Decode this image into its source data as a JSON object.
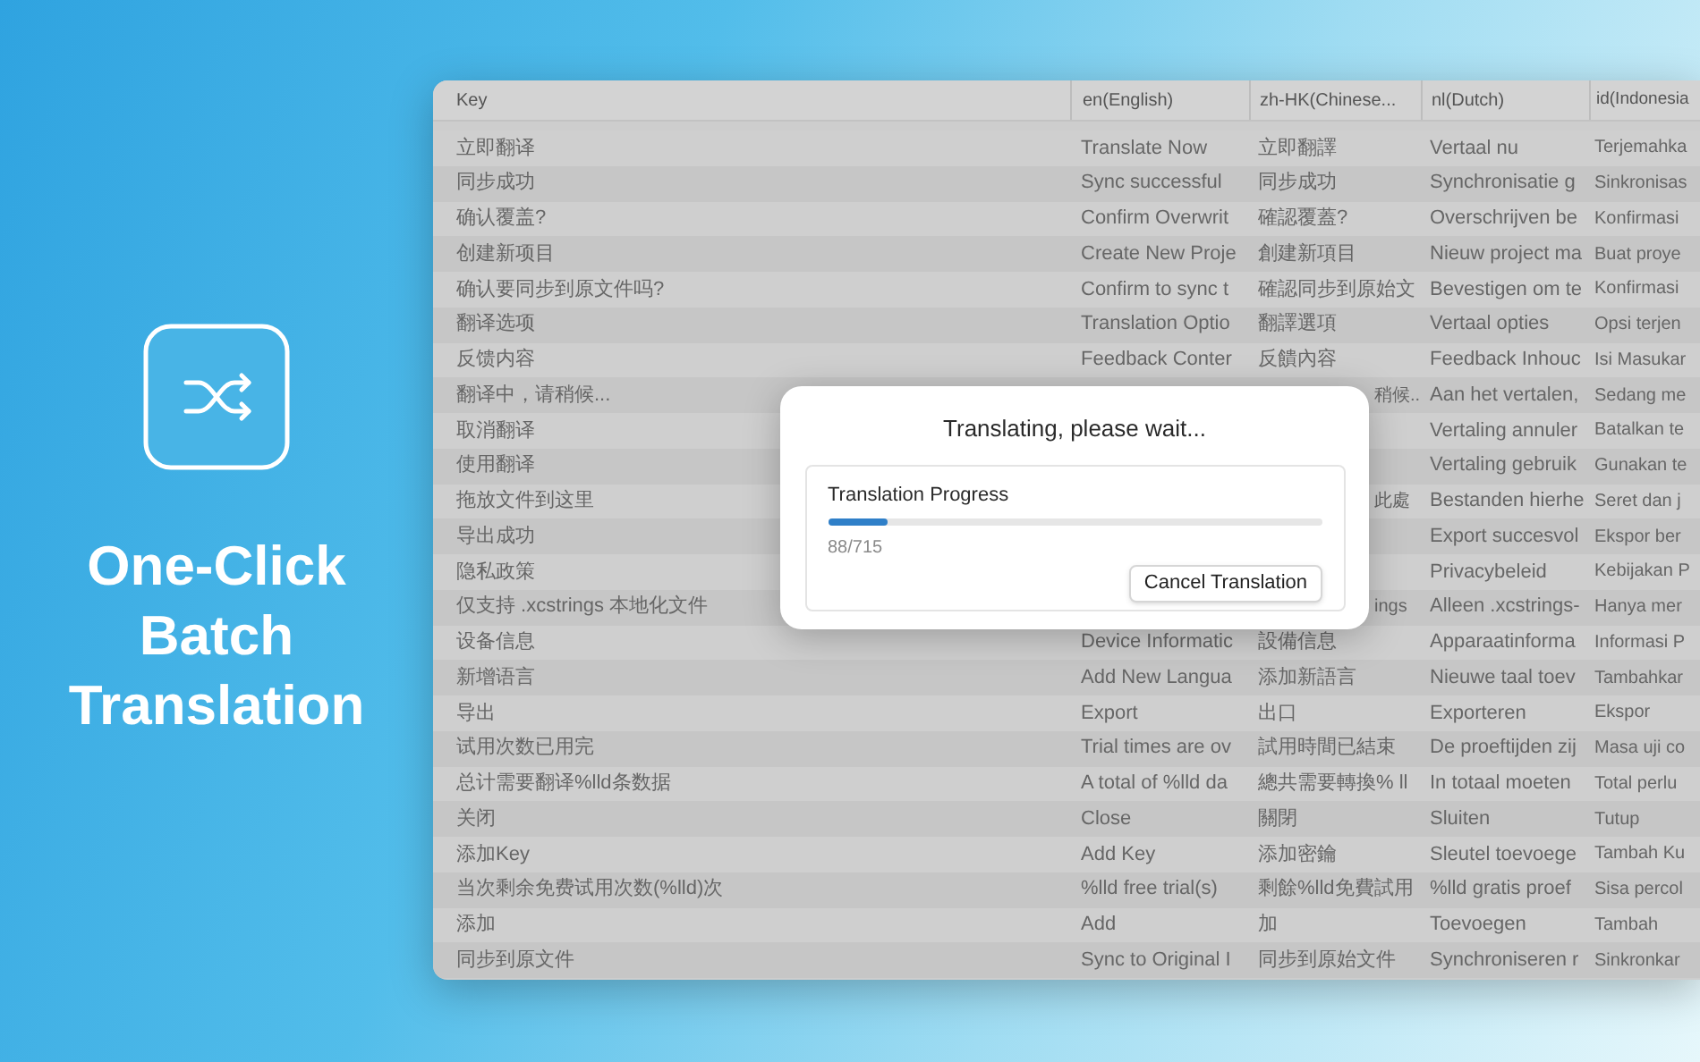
{
  "promo": {
    "headline": [
      "One-Click",
      "Batch",
      "Translation"
    ]
  },
  "table": {
    "columns": [
      "Key",
      "en(English)",
      "zh-HK(Chinese...",
      "nl(Dutch)",
      "id(Indonesia"
    ],
    "rows": [
      {
        "key": "立即翻译",
        "en": "Translate Now",
        "zh_hk": "立即翻譯",
        "nl": "Vertaal nu",
        "id": "Terjemahka"
      },
      {
        "key": "同步成功",
        "en": "Sync successful",
        "zh_hk": "同步成功",
        "nl": "Synchronisatie g",
        "id": "Sinkronisas"
      },
      {
        "key": "确认覆盖?",
        "en": "Confirm Overwrit",
        "zh_hk": "確認覆蓋?",
        "nl": "Overschrijven be",
        "id": "Konfirmasi"
      },
      {
        "key": "创建新项目",
        "en": "Create New Proje",
        "zh_hk": "創建新項目",
        "nl": "Nieuw project ma",
        "id": "Buat proye"
      },
      {
        "key": "确认要同步到原文件吗?",
        "en": "Confirm to sync t",
        "zh_hk": "確認同步到原始文",
        "nl": "Bevestigen om te",
        "id": "Konfirmasi"
      },
      {
        "key": "翻译选项",
        "en": "Translation Optio",
        "zh_hk": "翻譯選項",
        "nl": "Vertaal opties",
        "id": "Opsi terjen"
      },
      {
        "key": "反馈内容",
        "en": "Feedback Conter",
        "zh_hk": "反饋內容",
        "nl": "Feedback Inhouc",
        "id": "Isi Masukar"
      },
      {
        "key": "翻译中，请稍候...",
        "zh_hk": "稍候...",
        "nl": "Aan het vertalen,",
        "id": "Sedang me"
      },
      {
        "key": "取消翻译",
        "nl": "Vertaling annuler",
        "id": "Batalkan te"
      },
      {
        "key": "使用翻译",
        "nl": "Vertaling gebruik",
        "id": "Gunakan te"
      },
      {
        "key": "拖放文件到这里",
        "zh_hk": "此處",
        "nl": "Bestanden hierhe",
        "id": "Seret dan j"
      },
      {
        "key": "导出成功",
        "nl": "Export succesvol",
        "id": "Ekspor ber"
      },
      {
        "key": "隐私政策",
        "nl": "Privacybeleid",
        "id": "Kebijakan P"
      },
      {
        "key": "仅支持 .xcstrings 本地化文件",
        "zh_hk": "ings",
        "nl": "Alleen .xcstrings-",
        "id": "Hanya mer"
      },
      {
        "key": "设备信息",
        "en": "Device Informatic",
        "zh_hk": "設備信息",
        "nl": "Apparaatinforma",
        "id": "Informasi P"
      },
      {
        "key": "新增语言",
        "en": "Add New Langua",
        "zh_hk": "添加新語言",
        "nl": "Nieuwe taal toev",
        "id": "Tambahkar"
      },
      {
        "key": "导出",
        "en": "Export",
        "zh_hk": "出口",
        "nl": "Exporteren",
        "id": "Ekspor"
      },
      {
        "key": "试用次数已用完",
        "en": "Trial times are ov",
        "zh_hk": "試用時間已結束",
        "nl": "De proeftijden zij",
        "id": "Masa uji co"
      },
      {
        "key": "总计需要翻译%lld条数据",
        "en": "A total of %lld da",
        "zh_hk": "總共需要轉換% ll",
        "nl": "In totaal moeten",
        "id": "Total perlu"
      },
      {
        "key": "关闭",
        "en": "Close",
        "zh_hk": "關閉",
        "nl": "Sluiten",
        "id": "Tutup"
      },
      {
        "key": "添加Key",
        "en": "Add Key",
        "zh_hk": "添加密鑰",
        "nl": "Sleutel toevoege",
        "id": "Tambah Ku"
      },
      {
        "key": "当次剩余免费试用次数(%lld)次",
        "en": "%lld free trial(s)",
        "zh_hk": "剩餘%lld免費試用",
        "nl": "%lld gratis proef",
        "id": "Sisa percol"
      },
      {
        "key": "添加",
        "en": "Add",
        "zh_hk": "加",
        "nl": "Toevoegen",
        "id": "Tambah"
      },
      {
        "key": "同步到原文件",
        "en": "Sync to Original I",
        "zh_hk": "同步到原始文件",
        "nl": "Synchroniseren r",
        "id": "Sinkronkar"
      }
    ]
  },
  "dialog": {
    "title": "Translating, please wait...",
    "progress_label": "Translation Progress",
    "level": 0.123,
    "count": "88/715",
    "cancel_button": "Cancel Translation"
  }
}
